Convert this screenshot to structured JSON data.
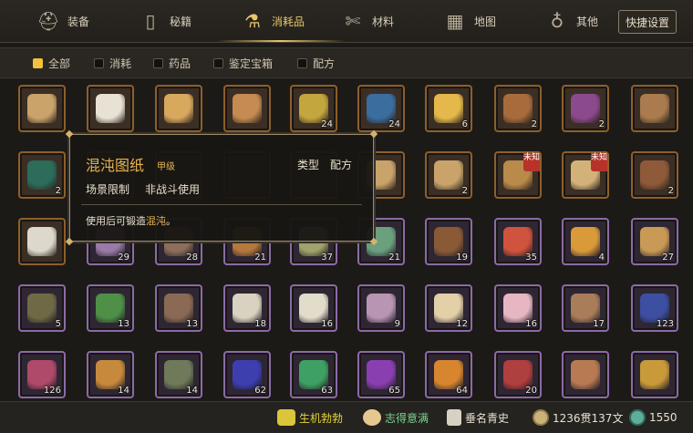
{
  "tabs": [
    {
      "label": "装备",
      "icon": "helmet-icon"
    },
    {
      "label": "秘籍",
      "icon": "book-icon"
    },
    {
      "label": "消耗品",
      "icon": "potion-flask-icon",
      "active": true
    },
    {
      "label": "材料",
      "icon": "tools-icon"
    },
    {
      "label": "地图",
      "icon": "map-icon"
    },
    {
      "label": "其他",
      "icon": "lamp-icon"
    }
  ],
  "quick_settings": "快捷设置",
  "filters": [
    {
      "label": "全部",
      "selected": true
    },
    {
      "label": "消耗",
      "selected": false
    },
    {
      "label": "药品",
      "selected": false
    },
    {
      "label": "鉴定宝箱",
      "selected": false
    },
    {
      "label": "配方",
      "selected": false
    }
  ],
  "grid": {
    "rows": [
      [
        {
          "icon": "scroll-bundle-icon",
          "border": "orange",
          "color": "#c9a36a",
          "count": ""
        },
        {
          "icon": "buns-icon",
          "border": "orange",
          "color": "#e8e2d5",
          "count": ""
        },
        {
          "icon": "roll-cake-icon",
          "border": "orange",
          "color": "#d8a85e",
          "count": ""
        },
        {
          "icon": "dim-sum-basket-icon",
          "border": "orange",
          "color": "#c58b52",
          "count": ""
        },
        {
          "icon": "gourd-bottle-icon",
          "border": "orange",
          "color": "#c4a63e",
          "count": "24"
        },
        {
          "icon": "incense-burner-icon",
          "border": "orange",
          "color": "#3b6d9e",
          "count": "24"
        },
        {
          "icon": "golden-orb-icon",
          "border": "orange",
          "color": "#e4b84a",
          "count": "6"
        },
        {
          "icon": "treasure-chest-blue-icon",
          "border": "orange",
          "color": "#a86c3c",
          "count": "2"
        },
        {
          "icon": "treasure-chest-purple-icon",
          "border": "orange",
          "color": "#8b4a8c",
          "count": "2"
        },
        {
          "icon": "book-icon",
          "border": "orange",
          "color": "#a97b4e",
          "count": ""
        }
      ],
      [
        {
          "icon": "green-book-icon",
          "border": "orange",
          "color": "#2d6b5a",
          "count": "2"
        },
        {
          "icon": "hidden-icon",
          "border": "orange",
          "color": "#3b2f25",
          "count": ""
        },
        {
          "icon": "hidden-icon",
          "border": "orange",
          "color": "#3b2f25",
          "count": ""
        },
        {
          "icon": "hidden-icon",
          "border": "orange",
          "color": "#3b2f25",
          "count": ""
        },
        {
          "icon": "hidden-icon",
          "border": "orange",
          "color": "#3b2f25",
          "count": ""
        },
        {
          "icon": "scroll-pair-icon",
          "border": "orange",
          "color": "#c9a36a",
          "count": ""
        },
        {
          "icon": "scroll-pair-icon",
          "border": "orange",
          "color": "#c9a36a",
          "count": "2"
        },
        {
          "icon": "unknown-recipe-icon",
          "border": "orange",
          "color": "#b98a4a",
          "count": "",
          "tag": "未知"
        },
        {
          "icon": "unknown-recipe-icon",
          "border": "orange",
          "color": "#d3b27a",
          "count": "",
          "tag": "未知"
        },
        {
          "icon": "wooden-chest-icon",
          "border": "orange",
          "color": "#8e5a3a",
          "count": "2"
        }
      ],
      [
        {
          "icon": "wine-cup-icon",
          "border": "orange",
          "color": "#ddd8cc",
          "count": ""
        },
        {
          "icon": "dish-icon",
          "border": "purple",
          "color": "#9a7aa8",
          "count": "29"
        },
        {
          "icon": "dish-icon",
          "border": "purple",
          "color": "#8d6e5a",
          "count": "28"
        },
        {
          "icon": "dish-icon",
          "border": "purple",
          "color": "#b5793e",
          "count": "21"
        },
        {
          "icon": "dish-icon",
          "border": "purple",
          "color": "#a0a36b",
          "count": "37"
        },
        {
          "icon": "dish-icon",
          "border": "purple",
          "color": "#6aa07e",
          "count": "21"
        },
        {
          "icon": "dish-icon",
          "border": "purple",
          "color": "#8a5a36",
          "count": "19"
        },
        {
          "icon": "dish-icon",
          "border": "purple",
          "color": "#d0533d",
          "count": "35"
        },
        {
          "icon": "dish-icon",
          "border": "purple",
          "color": "#d99a3a",
          "count": "4"
        },
        {
          "icon": "dish-icon",
          "border": "purple",
          "color": "#c99a55",
          "count": "27"
        }
      ],
      [
        {
          "icon": "dish-icon",
          "border": "purple",
          "color": "#6f6a45",
          "count": "5"
        },
        {
          "icon": "dish-icon",
          "border": "purple",
          "color": "#4f8f48",
          "count": "13"
        },
        {
          "icon": "dish-icon",
          "border": "purple",
          "color": "#8a6a55",
          "count": "13"
        },
        {
          "icon": "dish-icon",
          "border": "purple",
          "color": "#d9d2c0",
          "count": "18"
        },
        {
          "icon": "dish-icon",
          "border": "purple",
          "color": "#e2dccb",
          "count": "16"
        },
        {
          "icon": "dish-icon",
          "border": "purple",
          "color": "#b895b3",
          "count": "9"
        },
        {
          "icon": "dish-icon",
          "border": "purple",
          "color": "#e3cfa8",
          "count": "12"
        },
        {
          "icon": "dish-icon",
          "border": "purple",
          "color": "#e7b6c3",
          "count": "16"
        },
        {
          "icon": "dish-icon",
          "border": "purple",
          "color": "#a97d5a",
          "count": "17"
        },
        {
          "icon": "dish-icon",
          "border": "purple",
          "color": "#3d4fa0",
          "count": "123"
        }
      ],
      [
        {
          "icon": "dish-icon",
          "border": "purple",
          "color": "#b04a6a",
          "count": "126"
        },
        {
          "icon": "dish-icon",
          "border": "purple",
          "color": "#c78a3c",
          "count": "14"
        },
        {
          "icon": "dish-icon",
          "border": "purple",
          "color": "#6f7a5a",
          "count": "14"
        },
        {
          "icon": "dish-icon",
          "border": "purple",
          "color": "#3d3fb0",
          "count": "62"
        },
        {
          "icon": "dish-icon",
          "border": "purple",
          "color": "#3fa063",
          "count": "63"
        },
        {
          "icon": "dish-icon",
          "border": "purple",
          "color": "#8a3fb0",
          "count": "65"
        },
        {
          "icon": "dish-icon",
          "border": "purple",
          "color": "#d7862f",
          "count": "64"
        },
        {
          "icon": "dish-icon",
          "border": "purple",
          "color": "#b03f3f",
          "count": "20"
        },
        {
          "icon": "dish-icon",
          "border": "purple",
          "color": "#b77a52",
          "count": ""
        },
        {
          "icon": "dish-icon",
          "border": "purple",
          "color": "#c99a3a",
          "count": ""
        }
      ]
    ]
  },
  "tooltip": {
    "title": "混沌图纸",
    "grade": "甲级",
    "type_label": "类型",
    "type_value": "配方",
    "limit_label": "场景限制",
    "limit_value": "非战斗使用",
    "desc_prefix": "使用后可锻造",
    "desc_highlight": "混沌",
    "desc_suffix": "。"
  },
  "status": [
    {
      "label": "生机勃勃",
      "icon": "health-icon",
      "color": "#e3d33a"
    },
    {
      "label": "志得意满",
      "icon": "mood-icon",
      "color": "#79d68d"
    },
    {
      "label": "垂名青史",
      "icon": "fame-icon",
      "color": "#e9e2d2"
    },
    {
      "label": "1236贯137文",
      "icon": "coin-icon",
      "color": "#e9e2d2"
    },
    {
      "label": "1550",
      "icon": "jade-icon",
      "color": "#e9e2d2"
    }
  ]
}
